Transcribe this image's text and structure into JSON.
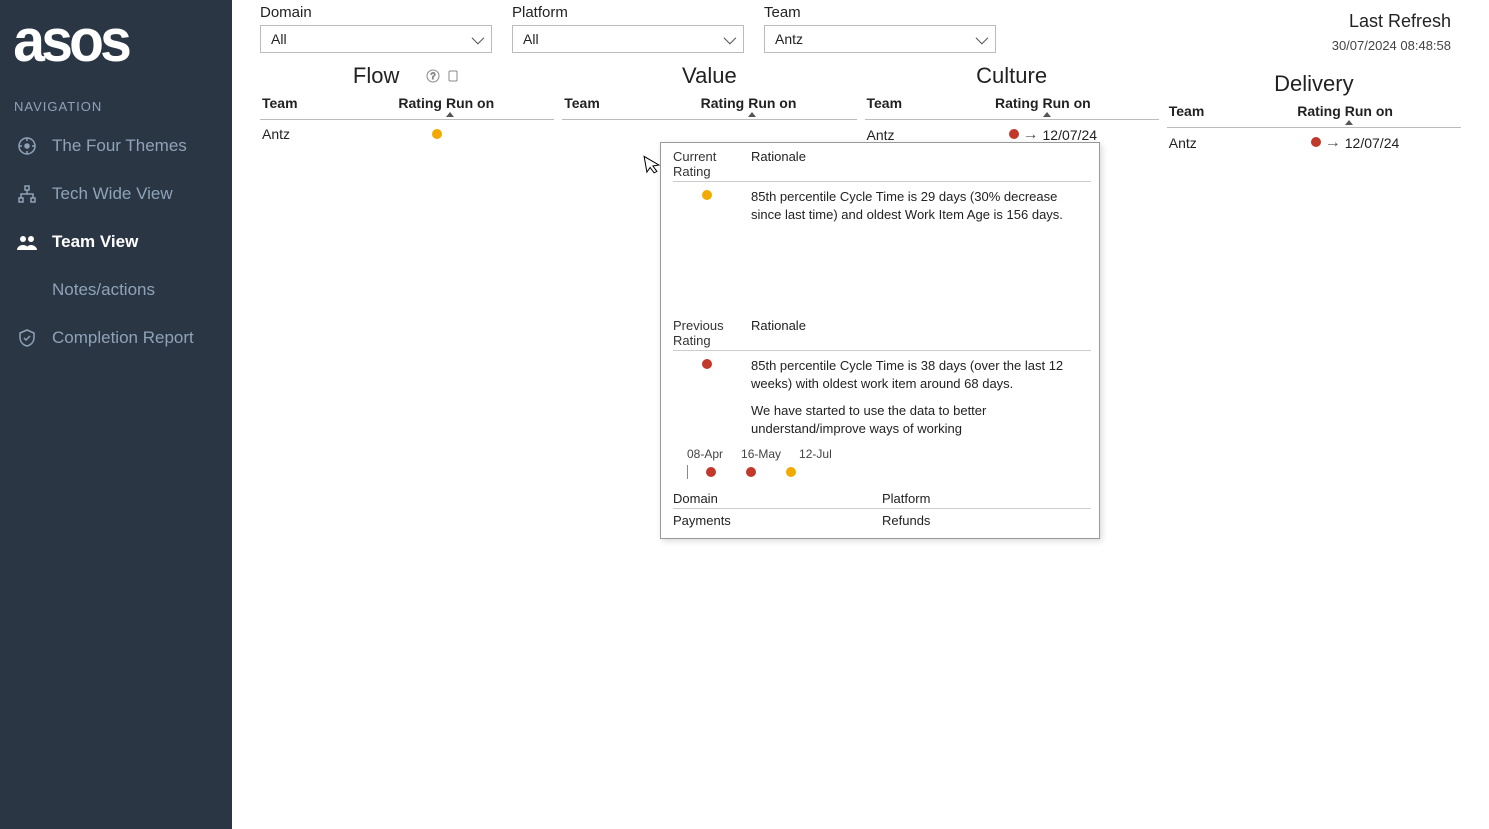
{
  "brand": "asos",
  "nav": {
    "header": "NAVIGATION",
    "items": [
      {
        "label": "The Four Themes"
      },
      {
        "label": "Tech Wide View"
      },
      {
        "label": "Team View"
      },
      {
        "label": "Notes/actions"
      },
      {
        "label": "Completion Report"
      }
    ]
  },
  "filters": {
    "domain": {
      "label": "Domain",
      "value": "All"
    },
    "platform": {
      "label": "Platform",
      "value": "All"
    },
    "team": {
      "label": "Team",
      "value": "Antz"
    }
  },
  "last_refresh": {
    "label": "Last Refresh",
    "value": "30/07/2024 08:48:58"
  },
  "panels": [
    {
      "title": "Flow",
      "cols": [
        "Team",
        "Rating",
        "Run on"
      ],
      "rows": [
        {
          "team": "Antz",
          "rating": "amber",
          "trend": "→",
          "run_on": ""
        }
      ]
    },
    {
      "title": "Value",
      "cols": [
        "Team",
        "Rating",
        "Run on"
      ],
      "rows": []
    },
    {
      "title": "Culture",
      "cols": [
        "Team",
        "Rating",
        "Run on"
      ],
      "rows": [
        {
          "team": "Antz",
          "rating": "red",
          "trend": "→",
          "run_on": "12/07/24"
        }
      ]
    },
    {
      "title": "Delivery",
      "cols": [
        "Team",
        "Rating",
        "Run on"
      ],
      "rows": [
        {
          "team": "Antz",
          "rating": "red",
          "trend": "→",
          "run_on": "12/07/24"
        }
      ]
    }
  ],
  "popover": {
    "current_h": "Current Rating",
    "rationale_h": "Rationale",
    "current": {
      "rating": "amber",
      "rationale": "85th percentile Cycle Time is 29 days (30% decrease since last time) and oldest Work Item Age is 156 days."
    },
    "previous_h": "Previous Rating",
    "previous": {
      "rating": "red",
      "rationale": "85th percentile Cycle Time is 38 days (over the last 12 weeks) with oldest work item around 68 days.",
      "note": "We have started to use the data to better understand/improve ways of working"
    },
    "timeline": {
      "labels": [
        "08-Apr",
        "16-May",
        "12-Jul"
      ],
      "ratings": [
        "red",
        "red",
        "amber"
      ]
    },
    "meta": {
      "domain_h": "Domain",
      "domain_v": "Payments",
      "platform_h": "Platform",
      "platform_v": "Refunds"
    }
  }
}
